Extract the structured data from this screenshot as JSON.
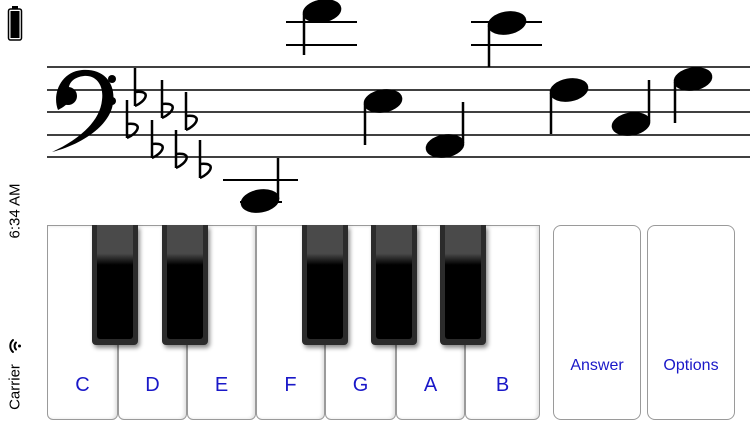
{
  "status_bar": {
    "time": "6:34 AM",
    "carrier": "Carrier",
    "battery_icon": "battery-icon",
    "wifi_icon": "wifi-icon"
  },
  "staff": {
    "clef": "bass-clef",
    "key_signature": "7 flats"
  },
  "piano": {
    "white_keys": [
      "C",
      "D",
      "E",
      "F",
      "G",
      "A",
      "B"
    ],
    "black_keys": [
      "C#",
      "D#",
      "F#",
      "G#",
      "A#"
    ]
  },
  "buttons": {
    "answer": "Answer",
    "options": "Options"
  },
  "colors": {
    "label_blue": "#1a18c8"
  }
}
